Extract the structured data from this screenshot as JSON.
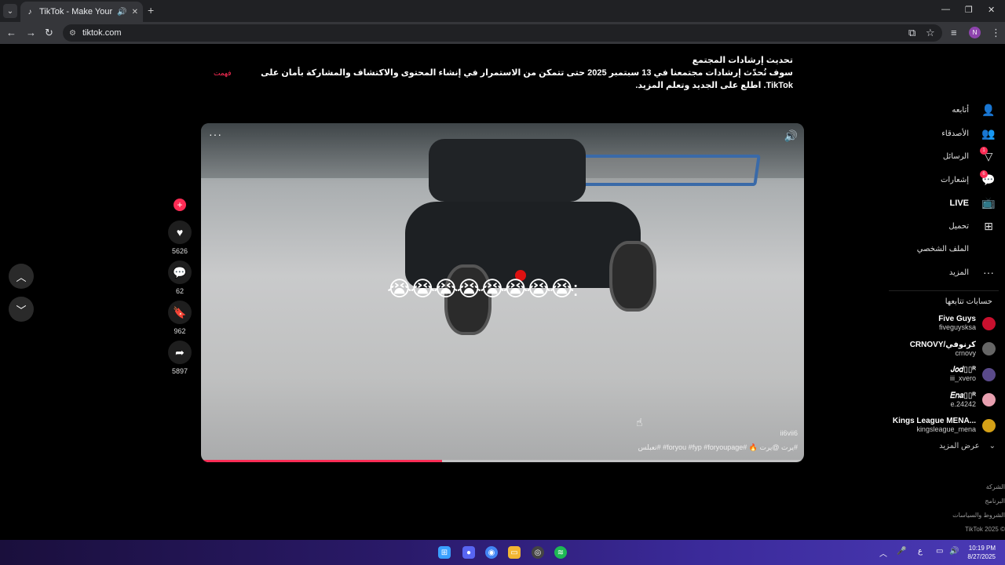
{
  "browser": {
    "tab_title": "TikTok - Make Your Day",
    "url": "tiktok.com",
    "profile_initial": "N"
  },
  "banner": {
    "title": "تحديث إرشادات المجتمع",
    "body": "سوف نُحدّث إرشادات مجتمعنا في 13 سبتمبر 2025 حتى تتمكن من الاستمرار في إنشاء المحتوى والاكتشاف والمشاركة بأمان على TikTok. اطلع على الجديد وتعلم المزيد.",
    "dismiss": "فهمت"
  },
  "video": {
    "emoji_overlay": "😭😭😭😭😭😭😭😭:",
    "username": "ii6vii6",
    "caption": "#يرت @يرت 🔥 #foryou #fyp #foryoupage# #تعبلس",
    "progress": 0.4
  },
  "actions": {
    "likes": "5626",
    "comments": "62",
    "saves": "962",
    "shares": "5897"
  },
  "sidebar": {
    "items": [
      {
        "label": "أتابعه",
        "icon": "user-follow-icon",
        "glyph": "👤"
      },
      {
        "label": "الأصدقاء",
        "icon": "friends-icon",
        "glyph": "👥"
      },
      {
        "label": "الرسائل",
        "icon": "messages-icon",
        "glyph": "▽",
        "badge": "1"
      },
      {
        "label": "إشعارات",
        "icon": "notifications-icon",
        "glyph": "💬",
        "badge": "6"
      },
      {
        "label": "LIVE",
        "icon": "live-icon",
        "glyph": "📺"
      },
      {
        "label": "تحميل",
        "icon": "upload-icon",
        "glyph": "⊞"
      },
      {
        "label": "الملف الشخصي",
        "icon": "profile-icon",
        "glyph": " "
      },
      {
        "label": "المزيد",
        "icon": "more-icon",
        "glyph": "···"
      }
    ],
    "following_title": "حسابات تتابعها",
    "accounts": [
      {
        "name": "Five Guys",
        "handle": "fiveguysksa",
        "color": "#c8102e"
      },
      {
        "name": "CRNOVY/كرنوفي",
        "handle": "crnovy",
        "color": "#666"
      },
      {
        "name": "𝐽𝑜𝑑▯▯ᴿ",
        "handle": "iii_xvero",
        "color": "#5a4a8a"
      },
      {
        "name": "𝐸𝑛𝑎▯▯ᴿ",
        "handle": "e.24242",
        "color": "#e8a0b0"
      },
      {
        "name": "Kings League MENA...",
        "handle": "kingsleague_mena",
        "color": "#d4a017"
      }
    ],
    "see_more": "عرض المزيد",
    "footer": [
      "الشركة",
      "البرنامج",
      "الشروط والسياسات",
      "© TikTok 2025"
    ]
  },
  "taskbar": {
    "time": "10:19 PM",
    "date": "8/27/2025",
    "lang": "ع"
  }
}
